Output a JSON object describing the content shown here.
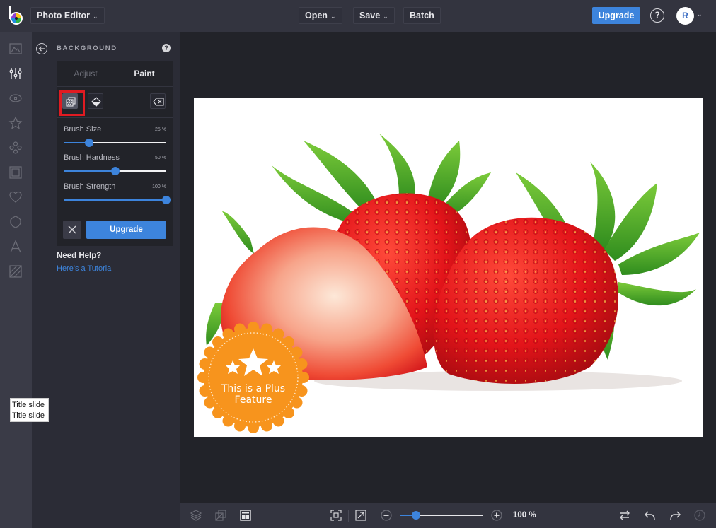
{
  "topbar": {
    "app_menu_label": "Photo Editor",
    "open_label": "Open",
    "save_label": "Save",
    "batch_label": "Batch",
    "upgrade_label": "Upgrade",
    "help_glyph": "?",
    "avatar_initial": "R"
  },
  "rail": {
    "items": [
      {
        "name": "image",
        "icon": "image-icon",
        "active": false
      },
      {
        "name": "adjust",
        "icon": "sliders-icon",
        "active": true
      },
      {
        "name": "effects",
        "icon": "eye-icon",
        "active": false
      },
      {
        "name": "favorites",
        "icon": "star-icon",
        "active": false
      },
      {
        "name": "graphics",
        "icon": "shapes-icon",
        "active": false
      },
      {
        "name": "frames",
        "icon": "frame-icon",
        "active": false
      },
      {
        "name": "overlays",
        "icon": "heart-icon",
        "active": false
      },
      {
        "name": "textures",
        "icon": "badge-icon",
        "active": false
      },
      {
        "name": "text",
        "icon": "text-icon",
        "active": false
      },
      {
        "name": "background",
        "icon": "hatch-icon",
        "active": false
      }
    ]
  },
  "panel": {
    "title": "BACKGROUND",
    "help_glyph": "?",
    "tabs": [
      {
        "label": "Adjust",
        "active": false
      },
      {
        "label": "Paint",
        "active": true
      }
    ],
    "sliders": [
      {
        "label": "Brush Size",
        "value_text": "25 %",
        "value": 25
      },
      {
        "label": "Brush Hardness",
        "value_text": "50 %",
        "value": 50
      },
      {
        "label": "Brush Strength",
        "value_text": "100 %",
        "value": 100
      }
    ],
    "upgrade_label": "Upgrade",
    "help_title": "Need Help?",
    "help_link": "Here's a Tutorial"
  },
  "tooltip": {
    "lines": [
      "Title slide",
      "Title slide"
    ]
  },
  "badge": {
    "line1": "This is a Plus",
    "line2": "Feature"
  },
  "bottombar": {
    "zoom_text": "100 %",
    "zoom_value": 20
  },
  "colors": {
    "accent": "#3d84dc",
    "highlight_outline": "#e11b22",
    "badge_orange": "#f7941d"
  }
}
